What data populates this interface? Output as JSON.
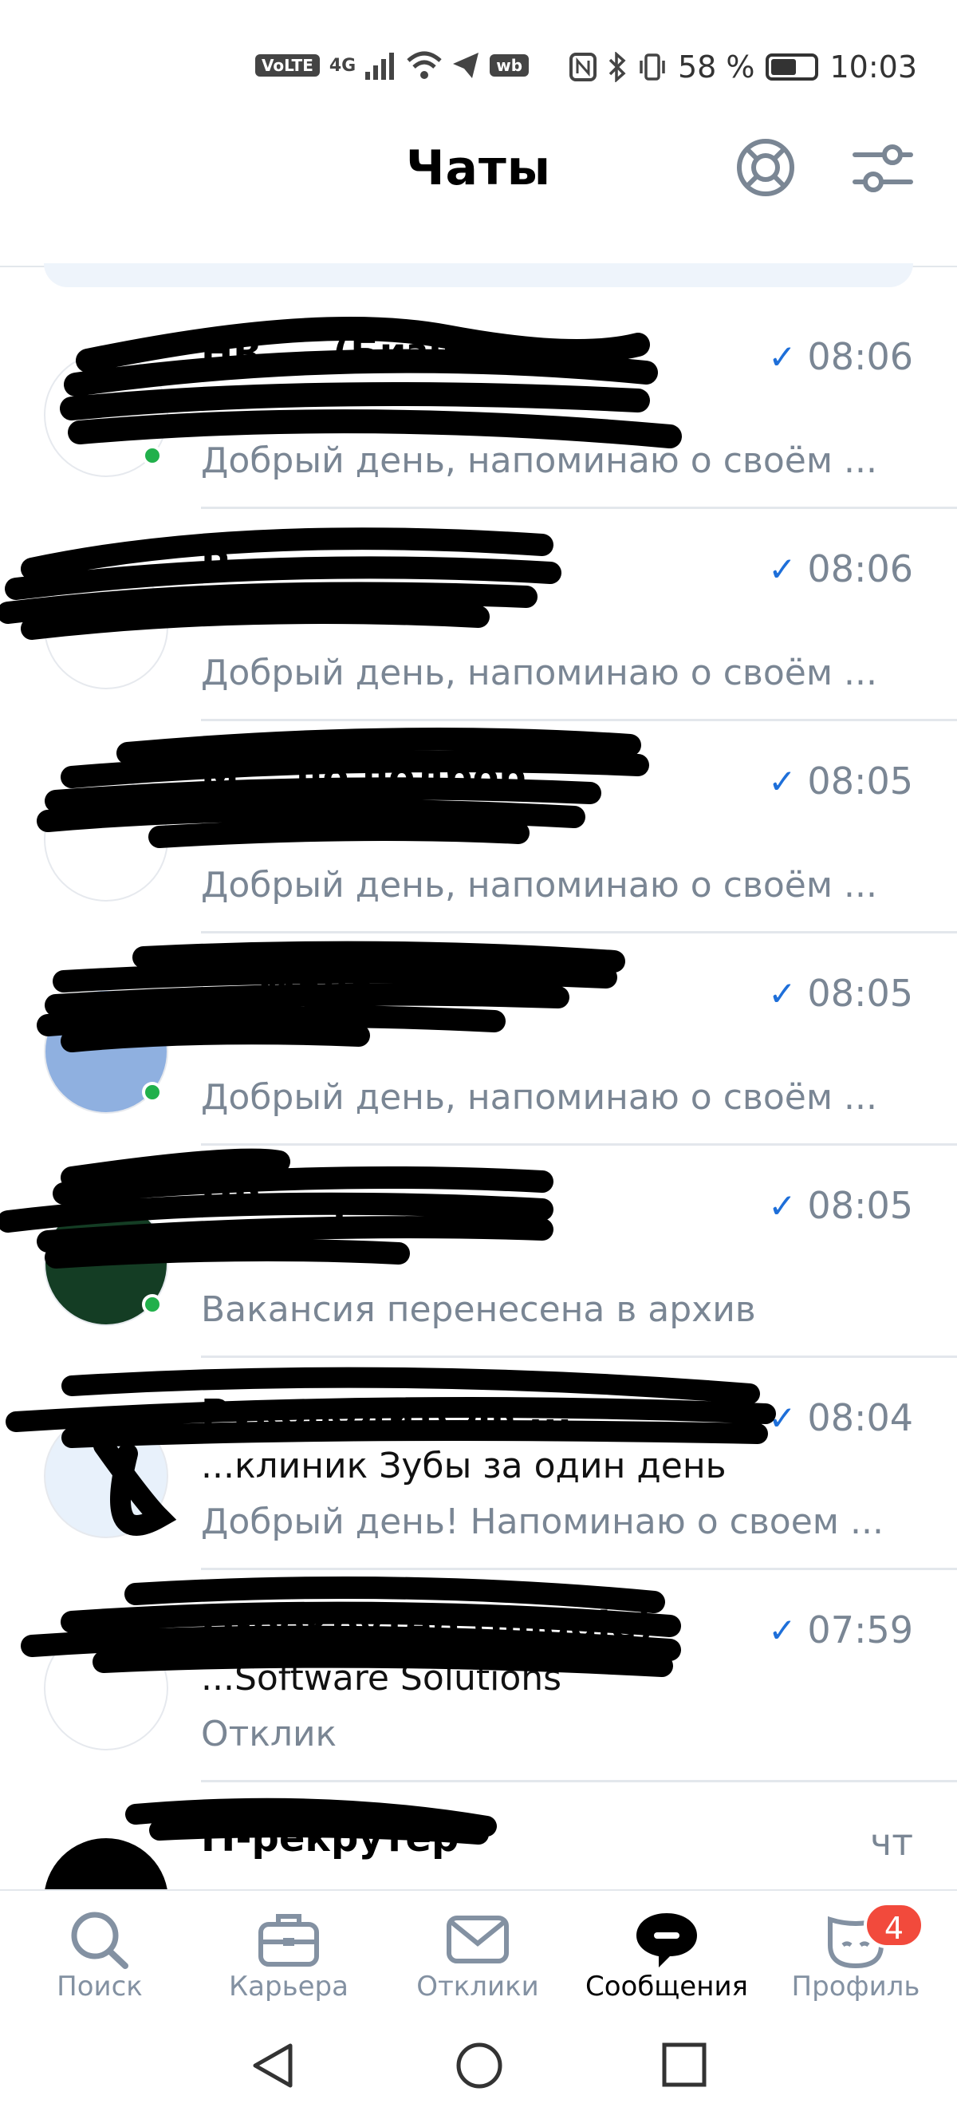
{
  "status_bar": {
    "carrier_chip": "VoLTE",
    "network": "4G",
    "app_chip": "wb",
    "battery_percent": "58 %",
    "time": "10:03"
  },
  "header": {
    "title": "Чаты",
    "support_icon": "lifebuoy-icon",
    "filter_icon": "sliders-icon"
  },
  "chats": [
    {
      "title": "HR ... (Бизн.",
      "subtitle": "",
      "preview": "Добрый день, напоминаю о своём ...",
      "time": "08:06",
      "read": true,
      "online": true
    },
    {
      "title": "Р...",
      "subtitle": "",
      "preview": "Добрый день, напоминаю о своём ...",
      "time": "08:06",
      "read": true,
      "online": false
    },
    {
      "title": "М... по подбор...",
      "subtitle": "Русский ...",
      "preview": "Добрый день, напоминаю о своём ...",
      "time": "08:05",
      "read": true,
      "online": false
    },
    {
      "title": "... Мене...",
      "subtitle": "...сьвы",
      "preview": "Добрый день, напоминаю о своём ...",
      "time": "08:05",
      "read": true,
      "online": true
    },
    {
      "title": "HR ... р",
      "subtitle": "...",
      "preview": "Вакансия перенесена в архив",
      "time": "08:05",
      "read": true,
      "online": true
    },
    {
      "title": "Руководитель ...",
      "subtitle": "...клиник Зубы за один день",
      "preview": "Добрый день! Напоминаю о своем ...",
      "time": "08:04",
      "read": true,
      "online": false
    },
    {
      "title": "IT-рекрутер (middle)",
      "subtitle": "...Software Solutions",
      "preview": "Отклик",
      "time": "07:59",
      "read": true,
      "online": false
    },
    {
      "title": "IT-рекрутер",
      "subtitle": "",
      "preview": "",
      "time": "чт",
      "read": false,
      "online": false
    }
  ],
  "tabs": [
    {
      "label": "Поиск",
      "icon": "search-icon",
      "active": false
    },
    {
      "label": "Карьера",
      "icon": "briefcase-icon",
      "active": false
    },
    {
      "label": "Отклики",
      "icon": "envelope-icon",
      "active": false
    },
    {
      "label": "Сообщения",
      "icon": "chat-bubble-icon",
      "active": true
    },
    {
      "label": "Профиль",
      "icon": "profile-face-icon",
      "active": false,
      "badge": "4"
    }
  ],
  "colors": {
    "accent": "#1e6fd9",
    "muted": "#7a8694",
    "online": "#21b04b",
    "badge": "#f24a3c"
  }
}
